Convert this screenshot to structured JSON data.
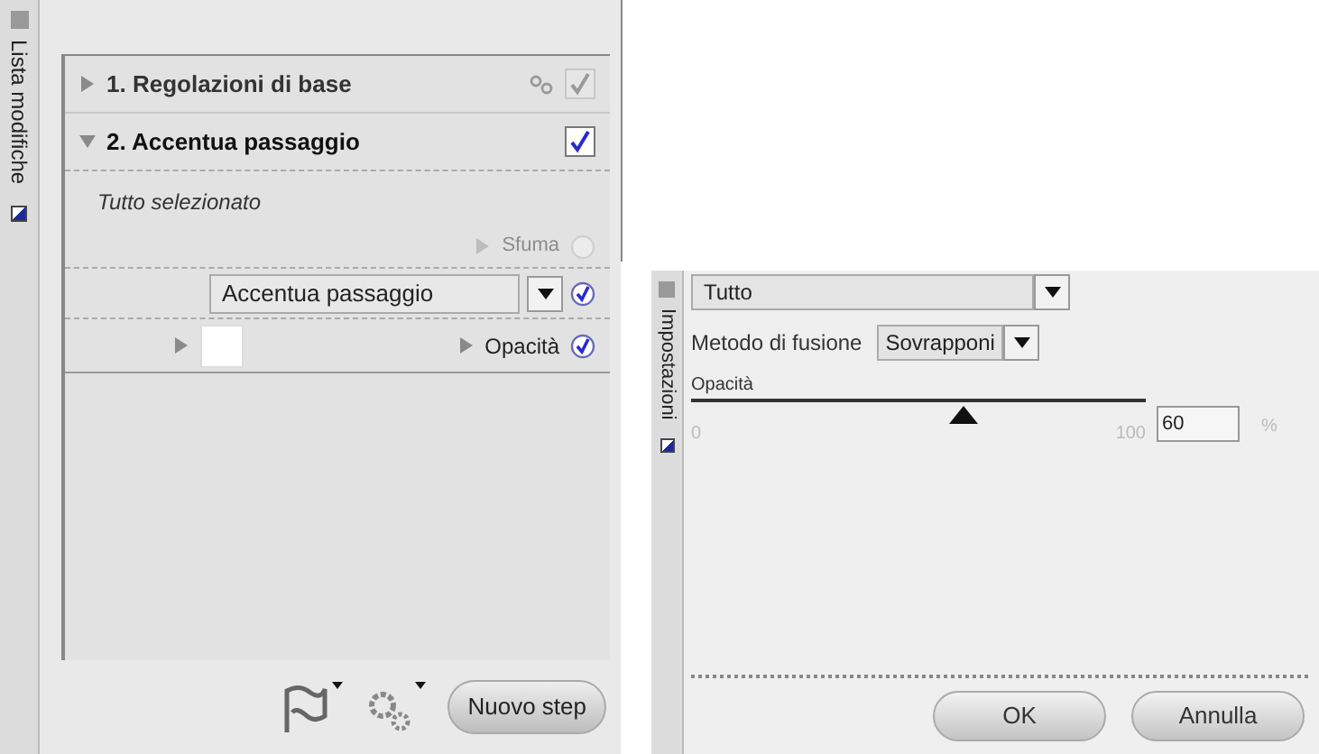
{
  "left_panel": {
    "tab_label": "Lista modifiche",
    "steps": [
      {
        "title": "1. Regolazioni di base",
        "expanded": false,
        "checked": true,
        "disabled": true
      },
      {
        "title": "2. Accentua passaggio",
        "expanded": true,
        "checked": true,
        "disabled": false
      }
    ],
    "selection_label": "Tutto selezionato",
    "feather": {
      "label": "Sfuma",
      "checked": false
    },
    "effect_dropdown": {
      "value": "Accentua passaggio",
      "checked": true
    },
    "opacity_toggle": {
      "label": "Opacità",
      "checked": true
    },
    "new_step_button": "Nuovo step"
  },
  "right_panel": {
    "tab_label": "Impostazioni",
    "scope_dropdown": {
      "value": "Tutto"
    },
    "blend_mode": {
      "label": "Metodo di fusione",
      "value": "Sovrapponi"
    },
    "opacity": {
      "label": "Opacità",
      "min": "0",
      "max": "100",
      "level": 0.6,
      "value": "60",
      "unit": "%"
    },
    "buttons": [
      "OK",
      "Annulla"
    ]
  }
}
